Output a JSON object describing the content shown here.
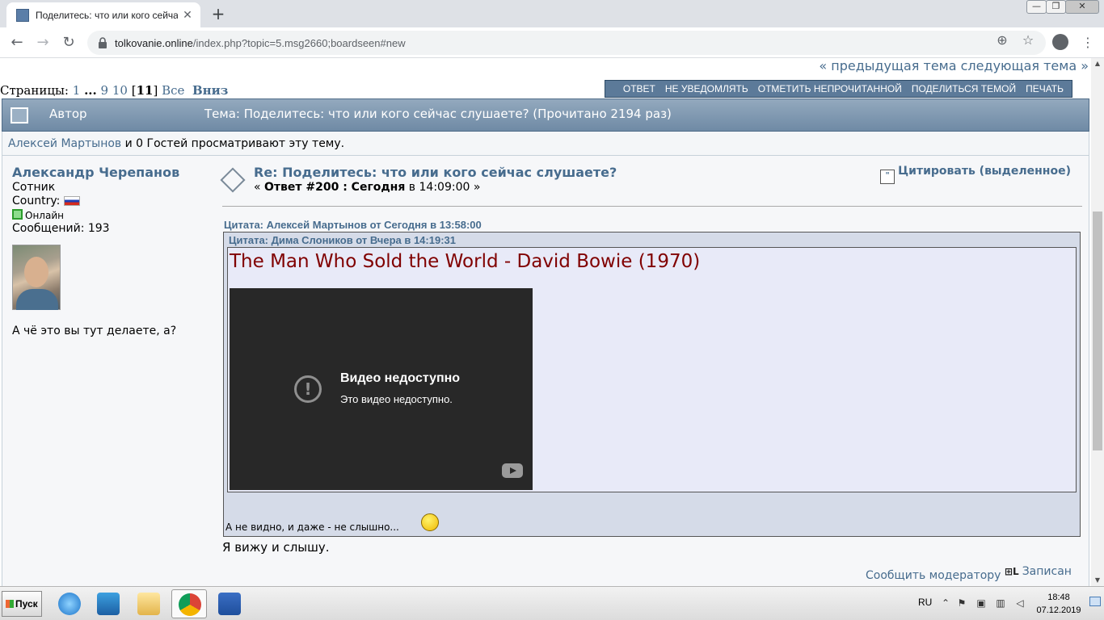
{
  "browser": {
    "tab_title": "Поделитесь: что или кого сейча",
    "url_host": "tolkovanie.online",
    "url_path": "/index.php?topic=5.msg2660;boardseen#new"
  },
  "nav": {
    "prev_next": "« предыдущая тема следующая тема »"
  },
  "pagination": {
    "label": "Страницы:",
    "p1": "1",
    "dots": "...",
    "p9": "9",
    "p10": "10",
    "current": "11",
    "all": "Все",
    "down": "Вниз"
  },
  "buttons": [
    "ОТВЕТ",
    "НЕ УВЕДОМЛЯТЬ",
    "ОТМЕТИТЬ НЕПРОЧИТАННОЙ",
    "ПОДЕЛИТЬСЯ ТЕМОЙ",
    "ПЕЧАТЬ"
  ],
  "header": {
    "author": "Автор",
    "topic": "Тема: Поделитесь: что или кого сейчас слушаете?  (Прочитано 2194 раз)"
  },
  "viewers": {
    "user": "Алексей Мартынов",
    "rest": " и 0 Гостей просматривают эту тему."
  },
  "poster": {
    "name": "Александр Черепанов",
    "rank": "Сотник",
    "country_label": "Country:",
    "online": "Онлайн",
    "posts": "Сообщений: 193",
    "signature": "А чё это вы тут делаете, а?"
  },
  "post": {
    "subject": "Re: Поделитесь: что или кого сейчас слушаете?",
    "meta_open": "« ",
    "meta_bold": "Ответ #200 : Сегодня",
    "meta_rest": " в 14:09:00 »",
    "quote_button": "Цитировать (выделенное)",
    "quote_outer_header": "Цитата: Алексей Мартынов от Сегодня в 13:58:00",
    "quote_inner_header": "Цитата: Дима Слоников от Вчера в 14:19:31",
    "song_title": "The Man Who Sold the World - David Bowie (1970)",
    "video_title": "Видео недоступно",
    "video_sub": "Это видео недоступно.",
    "quote_outer_text": "А не видно, и даже - не слышно...",
    "reply": "Я вижу и слышу.",
    "report": "Сообщить модератору",
    "logged": "Записан"
  },
  "taskbar": {
    "start": "Пуск",
    "lang": "RU",
    "time": "18:48",
    "date": "07.12.2019"
  }
}
